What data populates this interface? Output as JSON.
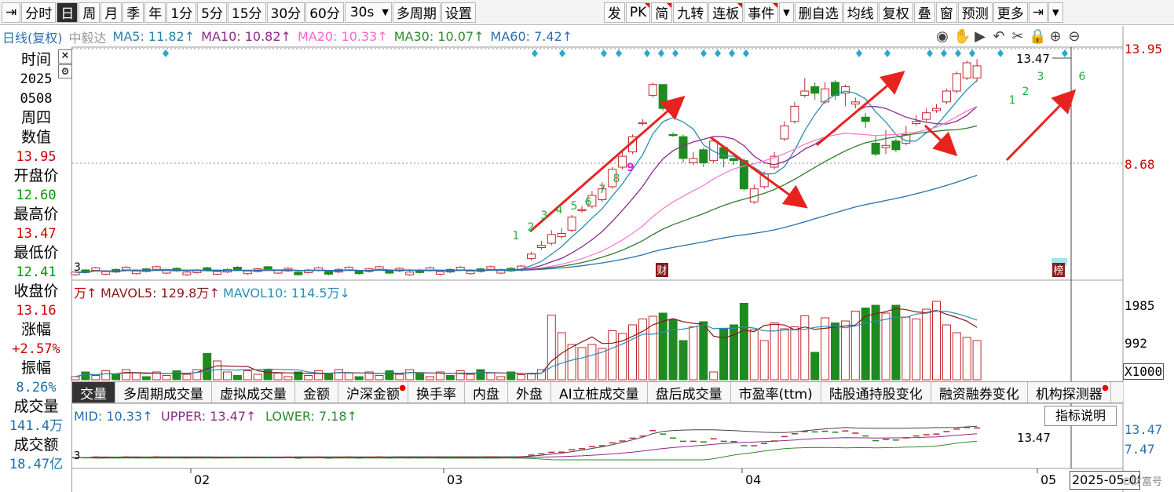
{
  "toolbar": {
    "left_items": [
      {
        "label": "⇥",
        "name": "pin-icon",
        "active": false
      },
      {
        "label": "分时",
        "name": "period-intraday",
        "active": false
      },
      {
        "label": "日",
        "name": "period-day",
        "active": true
      },
      {
        "label": "周",
        "name": "period-week",
        "active": false
      },
      {
        "label": "月",
        "name": "period-month",
        "active": false
      },
      {
        "label": "季",
        "name": "period-quarter",
        "active": false
      },
      {
        "label": "年",
        "name": "period-year",
        "active": false
      },
      {
        "label": "1分",
        "name": "period-1min",
        "active": false
      },
      {
        "label": "5分",
        "name": "period-5min",
        "active": false
      },
      {
        "label": "15分",
        "name": "period-15min",
        "active": false
      },
      {
        "label": "30分",
        "name": "period-30min",
        "active": false
      },
      {
        "label": "60分",
        "name": "period-60min",
        "active": false
      }
    ],
    "select_value": "30s",
    "mid_items": [
      {
        "label": "多周期",
        "name": "multi-period-button"
      },
      {
        "label": "设置",
        "name": "settings-button"
      }
    ],
    "right_items": [
      {
        "label": "发",
        "name": "publish-button",
        "flag": false
      },
      {
        "label": "PK",
        "name": "pk-button",
        "flag": true
      },
      {
        "label": "简",
        "name": "brief-button",
        "flag": true
      },
      {
        "label": "九转",
        "name": "nine-turn-button",
        "flag": false
      },
      {
        "label": "连板",
        "name": "limit-board-button",
        "flag": true
      },
      {
        "label": "事件",
        "name": "event-button",
        "flag": true
      },
      {
        "label": "▾",
        "name": "event-dropdown",
        "flag": false
      },
      {
        "label": "删自选",
        "name": "remove-watchlist-button",
        "flag": false
      },
      {
        "label": "均线",
        "name": "ma-button",
        "flag": false
      },
      {
        "label": "复权",
        "name": "adjust-button",
        "flag": false
      },
      {
        "label": "叠",
        "name": "overlay-button",
        "flag": false
      },
      {
        "label": "窗",
        "name": "window-button",
        "flag": false
      },
      {
        "label": "预测",
        "name": "forecast-button",
        "flag": false
      },
      {
        "label": "更多",
        "name": "more-button",
        "flag": false
      },
      {
        "label": "⇥",
        "name": "expand-icon",
        "flag": false
      },
      {
        "label": "▾",
        "name": "more-dropdown",
        "flag": false
      }
    ]
  },
  "infobar": {
    "period_label": "日线(复权)",
    "stock_name": "中毅达",
    "ma": [
      {
        "text": "MA5: 11.82↑",
        "color": "#2a7fa8"
      },
      {
        "text": "MA10: 10.82↑",
        "color": "#8b2a8b"
      },
      {
        "text": "MA20: 10.33↑",
        "color": "#ff66cc"
      },
      {
        "text": "MA30: 10.07↑",
        "color": "#2e8b2e"
      },
      {
        "text": "MA60: 7.42↑",
        "color": "#2a6fb0"
      }
    ],
    "icons": [
      "eye-icon",
      "hand-icon",
      "play-icon",
      "undo-icon",
      "scissors-icon",
      "lock-icon",
      "zoom-in-icon",
      "zoom-out-icon"
    ],
    "icon_glyphs": [
      "◉",
      "✋",
      "▶",
      "↶",
      "✂",
      "🔒",
      "⊕",
      "⊖"
    ]
  },
  "left_panel": {
    "close_glyph": "✕",
    "gear_glyph": "⚙",
    "rows": [
      {
        "label": "时间",
        "value": "2025"
      },
      {
        "label": "",
        "value": "0508"
      },
      {
        "label": "周四",
        "value": ""
      },
      {
        "label": "数值",
        "value": "13.95",
        "value_color": "#c00"
      },
      {
        "label": "开盘价",
        "value": "12.60",
        "value_color": "#090"
      },
      {
        "label": "最高价",
        "value": "13.47",
        "value_color": "#c00"
      },
      {
        "label": "最低价",
        "value": "12.41",
        "value_color": "#090"
      },
      {
        "label": "收盘价",
        "value": "13.16",
        "value_color": "#c00"
      },
      {
        "label": "涨幅",
        "value": "+2.57%",
        "value_color": "#c00"
      },
      {
        "label": "振幅",
        "value": "8.26%",
        "value_color": "#1a6fa8"
      },
      {
        "label": "成交量",
        "value": "141.4万",
        "value_color": "#1a6fa8"
      },
      {
        "label": "成交额",
        "value": "18.47亿",
        "value_color": "#1a6fa8"
      }
    ]
  },
  "price_axis": {
    "top_label": "13.95",
    "mid_label": "8.68",
    "max_label": "13.47",
    "min_label": "3"
  },
  "nine_turn_labels": [
    "1",
    "2",
    "3",
    "4",
    "5",
    "6",
    "7",
    "8",
    "9",
    "1",
    "2",
    "3",
    "6"
  ],
  "event_markers": [
    "财",
    "榜"
  ],
  "volume_info": {
    "vol_label": "万↑",
    "mavol5": "MAVOL5: 129.8万↑",
    "mavol10": "MAVOL10: 114.5万↓",
    "axis_labels": [
      "1985",
      "992"
    ],
    "unit": "X1000"
  },
  "tabs": [
    {
      "label": "交量",
      "active": true,
      "dot": false
    },
    {
      "label": "多周期成交量",
      "active": false,
      "dot": false
    },
    {
      "label": "虚拟成交量",
      "active": false,
      "dot": false
    },
    {
      "label": "金额",
      "active": false,
      "dot": false
    },
    {
      "label": "沪深金额",
      "active": false,
      "dot": true
    },
    {
      "label": "换手率",
      "active": false,
      "dot": false
    },
    {
      "label": "内盘",
      "active": false,
      "dot": false
    },
    {
      "label": "外盘",
      "active": false,
      "dot": false
    },
    {
      "label": "AI立桩成交量",
      "active": false,
      "dot": false
    },
    {
      "label": "盘后成交量",
      "active": false,
      "dot": false
    },
    {
      "label": "市盈率(ttm)",
      "active": false,
      "dot": false
    },
    {
      "label": "陆股通持股变化",
      "active": false,
      "dot": false
    },
    {
      "label": "融资融券变化",
      "active": false,
      "dot": false
    },
    {
      "label": "机构探测器",
      "active": false,
      "dot": true
    }
  ],
  "boll": {
    "mid": "MID: 10.33↑",
    "upper": "UPPER: 13.47↑",
    "lower": "LOWER: 7.18↑",
    "axis_labels": [
      "13.47",
      "7.47"
    ],
    "max_label": "13.47",
    "min_label": "3",
    "help_button": "指标说明"
  },
  "date_axis": {
    "labels": [
      "02",
      "03",
      "04",
      "05"
    ],
    "current": "2025-05-08"
  },
  "colors": {
    "up": "#c0282d",
    "down": "#1f8a1f",
    "ma5": "#2a8fb5",
    "ma10": "#8b2a8b",
    "ma20": "#ff7ad0",
    "ma30": "#2e7d2e",
    "ma60": "#2a6fb0",
    "arrow": "#e8231f",
    "marker": "#2aa8c8"
  },
  "watermark": "©财富号"
}
